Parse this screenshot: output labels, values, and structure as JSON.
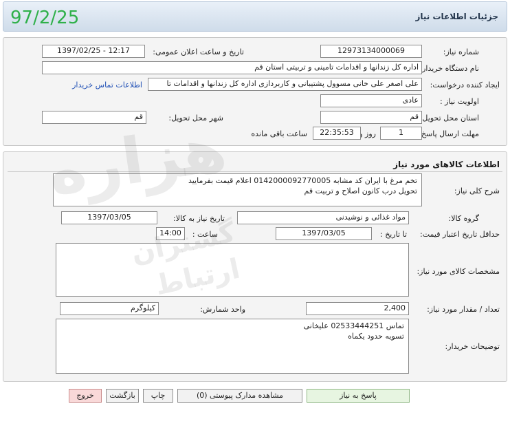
{
  "header": {
    "title": "جزئیات اطلاعات نیاز",
    "date_stamp": "97/2/25"
  },
  "info": {
    "need_number_label": "شماره نیاز:",
    "need_number": "12973134000069",
    "announce_label": "تاریخ و ساعت اعلان عمومی:",
    "announce_value": "1397/02/25 - 12:17",
    "buyer_org_label": "نام دستگاه خریدار:",
    "buyer_org": "اداره کل زندانها و اقدامات تامینی و تربیتی استان قم",
    "creator_label": "ایجاد کننده درخواست:",
    "creator": "علی اصغر علی خانی مسوول پشتیبانی و کاربردازی اداره کل زندانها و اقدامات تا",
    "contact_link": "اطلاعات تماس خریدار",
    "priority_label": "اولویت نیاز :",
    "priority": "عادی",
    "province_label": "استان محل تحویل:",
    "province": "قم",
    "city_label": "شهر محل تحویل:",
    "city": "قم",
    "deadline_label": "مهلت ارسال پاسخ:",
    "deadline_days": "1",
    "days_word": "روز و",
    "deadline_time": "22:35:53",
    "remaining_text": "ساعت باقی مانده"
  },
  "goods": {
    "section_title": "اطلاعات کالاهای مورد نیاز",
    "desc_label": "شرح کلی نیاز:",
    "desc_line1": "تخم مرغ با ایران کد مشابه 0142000092770005 اعلام قیمت بفرمایید",
    "desc_line2": "تحویل درب کانون اصلاح و تربیت قم",
    "group_label": "گروه کالا:",
    "group": "مواد غذائی و نوشیدنی",
    "need_date_label": "تاریخ نیاز به کالا:",
    "need_date": "1397/03/05",
    "min_validity_label": "حداقل تاریخ اعتبار قیمت:",
    "until_date_label": "تا تاریخ :",
    "until_date": "1397/03/05",
    "time_label": "ساعت :",
    "time": "14:00",
    "specs_label": "مشخصات کالای مورد نیاز:",
    "specs": "",
    "qty_label": "تعداد / مقدار مورد نیاز:",
    "qty": "2,400",
    "unit_label": "واحد شمارش:",
    "unit": "کیلوگرم",
    "buyer_notes_label": "توضیحات خریدار:",
    "notes_line1": "تماس 02533444251 علیخانی",
    "notes_line2": "تسویه حدود یکماه"
  },
  "buttons": {
    "reply": "پاسخ به نیاز",
    "attachments": "مشاهده مدارک پیوستی (0)",
    "print": "چاپ",
    "back": "بازگشت",
    "exit": "خروج"
  },
  "watermark": {
    "main": "هزاره",
    "sub1": "گستران",
    "sub2": "ارتباط"
  },
  "colors": {
    "date_stamp": "#2fb04a",
    "link": "#1f4fb5",
    "reply_button": "#e7f5e1",
    "exit_button": "#f9d9d9"
  }
}
